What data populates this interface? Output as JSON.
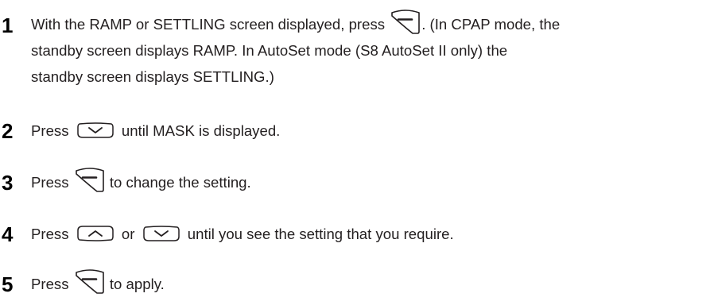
{
  "steps": [
    {
      "number": "1",
      "line1_a": "With the RAMP or SETTLING screen displayed, press",
      "line1_b": ". (In CPAP mode, the",
      "line2": "standby screen displays RAMP. In AutoSet mode (S8 AutoSet II only) the",
      "line3": "standby screen displays SETTLING.)"
    },
    {
      "number": "2",
      "text_a": "Press",
      "text_b": "until MASK is displayed."
    },
    {
      "number": "3",
      "text_a": "Press",
      "text_b": "to change the setting."
    },
    {
      "number": "4",
      "text_a": "Press",
      "text_mid": "or",
      "text_b": "until you see the setting that you require."
    },
    {
      "number": "5",
      "text_a": "Press",
      "text_b": "to apply."
    }
  ],
  "icons": {
    "enter": "enter-key-icon",
    "down": "down-key-icon",
    "up": "up-key-icon"
  }
}
